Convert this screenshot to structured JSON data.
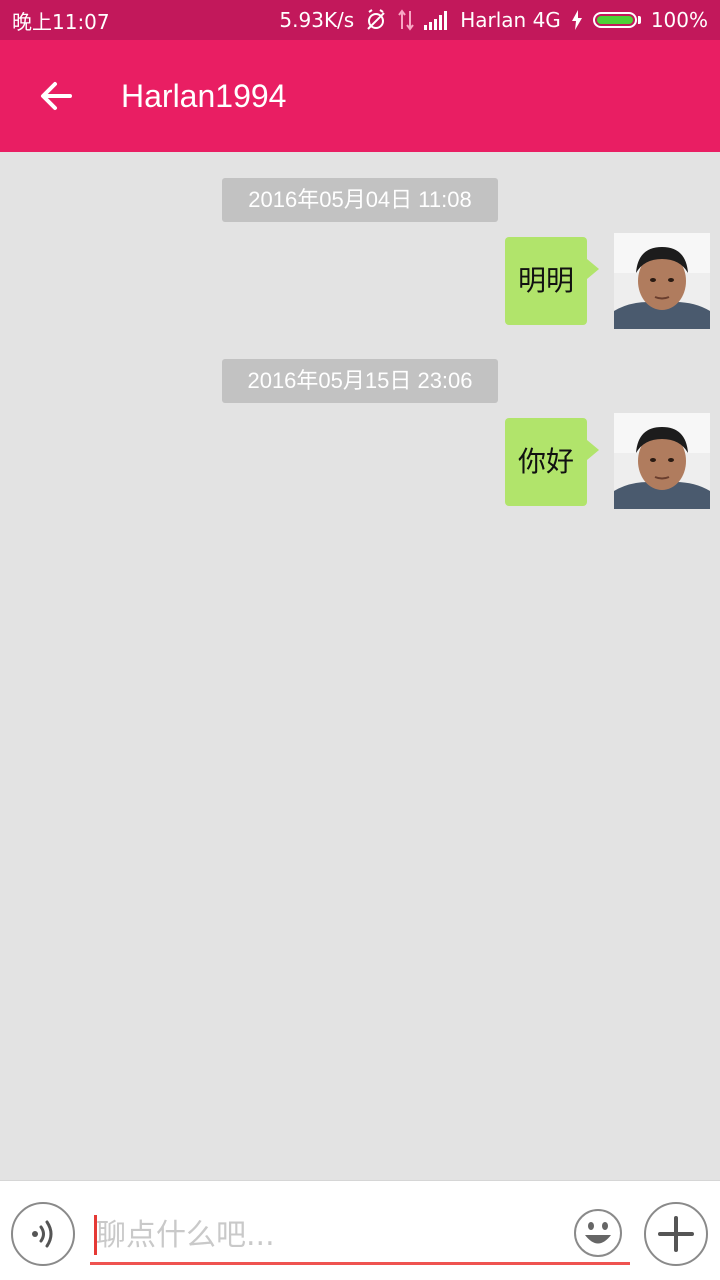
{
  "status_bar": {
    "time": "晚上11:07",
    "net_speed": "5.93K/s",
    "carrier": "Harlan 4G",
    "battery_percent_label": "100%",
    "battery_level": 1.0,
    "icons": [
      "alarm-off-icon",
      "data-arrows-icon",
      "signal-icon",
      "charging-icon",
      "battery-icon"
    ],
    "colors": {
      "background": "#c2185b",
      "battery": "#4cd137"
    }
  },
  "app_bar": {
    "title": "Harlan1994",
    "back_icon": "arrow-left-icon",
    "color": "#e91e63"
  },
  "messages": [
    {
      "timestamp": "2016年05月04日 11:08",
      "text": "明明",
      "sender": "self"
    },
    {
      "timestamp": "2016年05月15日 23:06",
      "text": "你好",
      "sender": "self"
    }
  ],
  "bubble_color": "#b1e46b",
  "input_bar": {
    "placeholder": "聊点什么吧...",
    "value": "",
    "voice_icon": "voice-icon",
    "emoji_icon": "emoji-icon",
    "plus_icon": "plus-icon",
    "underline_color": "#ef5350"
  }
}
